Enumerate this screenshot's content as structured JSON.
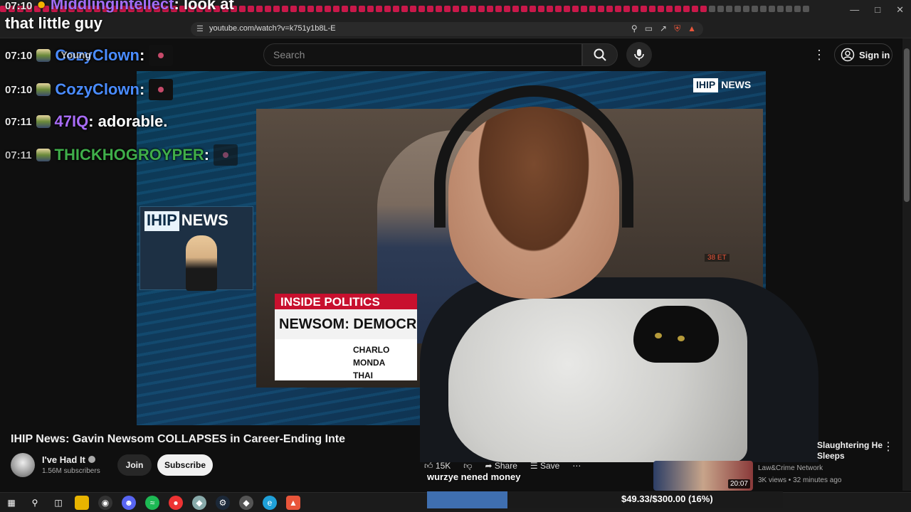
{
  "browser": {
    "url": "youtube.com/watch?v=k751y1b8L-E"
  },
  "yt_header": {
    "search_placeholder": "Search",
    "sign_in_label": "Sign in"
  },
  "chat": {
    "top": {
      "time": "07:10",
      "user": "Middlingintellect",
      "message": "look at",
      "continuation": "that little guy"
    },
    "lines": [
      {
        "time": "07:10",
        "user": "CozyClown",
        "user_color": "#4a8cff",
        "message": "",
        "overlap": "Young"
      },
      {
        "time": "07:10",
        "user": "CozyClown",
        "user_color": "#4a8cff",
        "message": ""
      },
      {
        "time": "07:11",
        "user": "47IQ",
        "user_color": "#a86cf6",
        "message": "adorable."
      },
      {
        "time": "07:11",
        "user": "THICKHOGROYPER",
        "user_color": "#3fae4a",
        "message": ""
      }
    ]
  },
  "video": {
    "logo_a": "IHIP",
    "logo_b": "NEWS",
    "chyron_top": "INSIDE POLITICS",
    "chyron_main": "NEWSOM: DEMOCRATIC",
    "chyron_sub": [
      "CHARLO",
      "MONDA",
      "THAI"
    ],
    "inset_time": "38 ET"
  },
  "video_info": {
    "title": "IHIP News: Gavin Newsom COLLAPSES in Career-Ending Interview",
    "channel": "I've Had It",
    "subscribers": "1.56M subscribers",
    "join_label": "Join",
    "subscribe_label": "Subscribe",
    "likes": "15K",
    "share_label": "Share",
    "save_label": "Save"
  },
  "donation": {
    "message": "wurzye nened money",
    "goal_text": "$49.33/$300.00 (16%)",
    "goal_fraction": 0.1644
  },
  "recommendation": {
    "title": "Slaughtering He Sleeps",
    "channel": "Law&Crime Network",
    "meta": "3K views • 32 minutes ago",
    "duration": "20:07"
  },
  "colors": {
    "accent_red": "#c8102e",
    "goal_fill": "#3f6fb0"
  }
}
